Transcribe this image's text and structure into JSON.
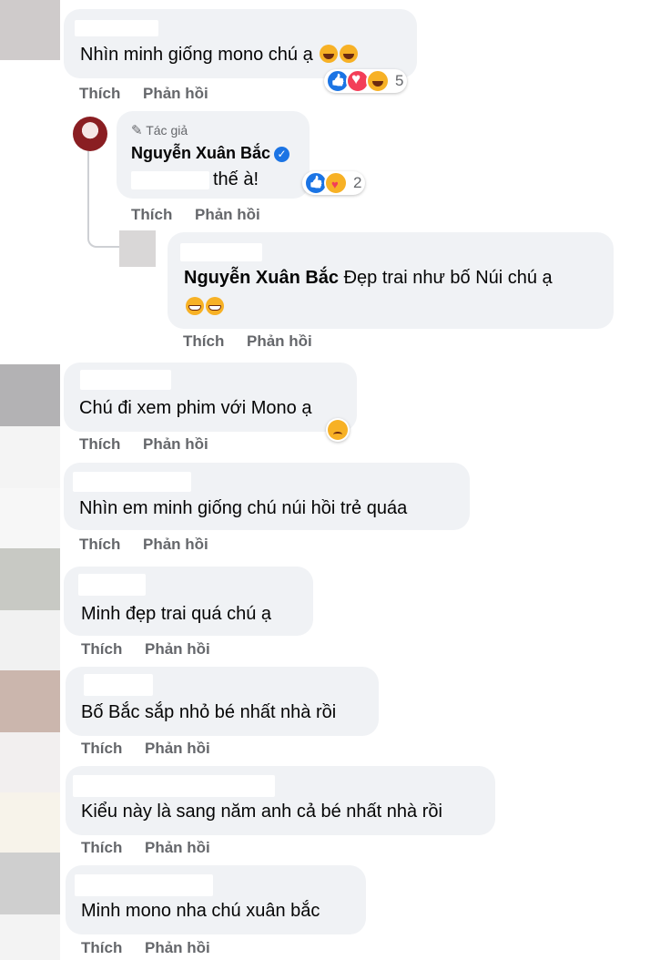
{
  "comments": [
    {
      "text": "Nhìn minh giống mono chú ạ",
      "reaction_count": "5"
    },
    {
      "text": "Chú đi xem phim với Mono ạ"
    },
    {
      "text": "Nhìn em minh giống chú núi hồi trẻ quáa"
    },
    {
      "text": "Minh đẹp trai quá chú ạ"
    },
    {
      "text": "Bố Bắc sắp nhỏ bé nhất nhà rồi"
    },
    {
      "text": "Kiểu này là sang năm anh cả bé nhất nhà rồi"
    },
    {
      "text": "Minh mono nha chú xuân bắc"
    }
  ],
  "author_reply": {
    "badge": "Tác giả",
    "name": "Nguyễn Xuân Bắc",
    "text": "thế à!",
    "reaction_count": "2"
  },
  "nested_reply": {
    "mention": "Nguyễn Xuân Bắc",
    "text": "Đẹp trai như bố Núi chú ạ"
  },
  "actions": {
    "like": "Thích",
    "reply": "Phản hồi"
  },
  "icons": [
    "like-icon",
    "love-icon",
    "haha-icon",
    "care-icon",
    "sad-icon",
    "pencil-icon",
    "verified-icon"
  ],
  "colors": {
    "bubble": "#f0f2f5",
    "action_text": "#65676b",
    "link_blue": "#1b74e4"
  }
}
